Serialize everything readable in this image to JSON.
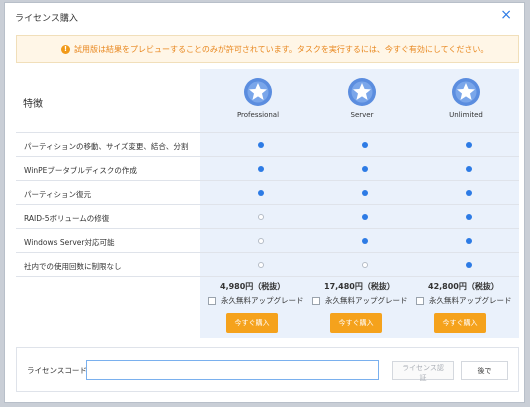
{
  "dialog": {
    "title": "ライセンス購入",
    "close_symbol": "×"
  },
  "notice": {
    "icon_symbol": "!",
    "text": "試用版は結果をプレビューすることのみが許可されています。タスクを実行するには、今すぐ有効にしてください。"
  },
  "features_title": "特徴",
  "plans": [
    {
      "name": "Professional"
    },
    {
      "name": "Server"
    },
    {
      "name": "Unlimited"
    }
  ],
  "features": [
    {
      "label": "パーティションの移動、サイズ変更、結合、分割",
      "support": [
        true,
        true,
        true
      ]
    },
    {
      "label": "WinPEブータブルディスクの作成",
      "support": [
        true,
        true,
        true
      ]
    },
    {
      "label": "パーティション復元",
      "support": [
        true,
        true,
        true
      ]
    },
    {
      "label": "RAID-5ボリュームの修復",
      "support": [
        false,
        true,
        true
      ]
    },
    {
      "label": "Windows Server対応可能",
      "support": [
        false,
        true,
        true
      ]
    },
    {
      "label": "社内での使用回数に制限なし",
      "support": [
        false,
        false,
        true
      ]
    }
  ],
  "pricing": [
    {
      "price": "4,980円（税抜）",
      "upgrade": "永久無料アップグレード",
      "buy": "今すぐ購入"
    },
    {
      "price": "17,480円（税抜）",
      "upgrade": "永久無料アップグレード",
      "buy": "今すぐ購入"
    },
    {
      "price": "42,800円（税抜）",
      "upgrade": "永久無料アップグレード",
      "buy": "今すぐ購入"
    }
  ],
  "license": {
    "label": "ライセンスコード",
    "input_value": "",
    "authenticate_label": "ライセンス認証",
    "later_label": "後で"
  },
  "colors": {
    "accent": "#2d7be5",
    "buy": "#f5a21c",
    "notice_text": "#e8871e",
    "column_bg": "#eaf1fb"
  }
}
